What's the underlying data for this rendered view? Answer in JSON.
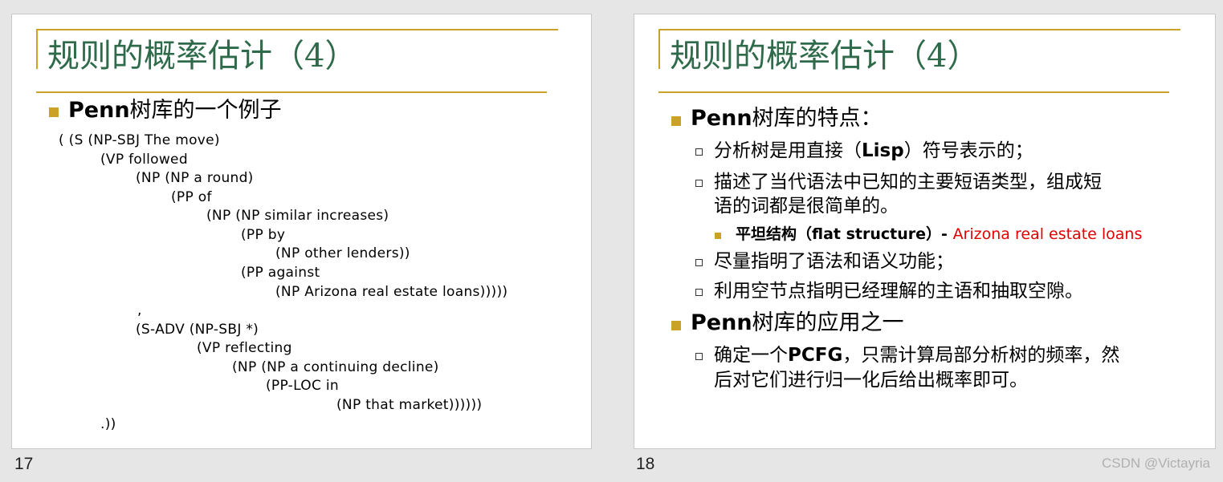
{
  "slide17": {
    "title": "规则的概率估计（4）",
    "heading_bold": "Penn",
    "heading_rest": "树库的一个例子",
    "code_lines": [
      "( (S (NP-SBJ The move)",
      "(VP followed",
      "(NP (NP a round)",
      "(PP of",
      "(NP (NP similar increases)",
      "(PP by",
      "(NP other lenders))",
      "(PP against",
      "(NP Arizona real estate loans)))))",
      ",",
      "(S-ADV (NP-SBJ *)",
      "(VP reflecting",
      "(NP (NP a continuing decline)",
      "(PP-LOC in",
      "(NP that market))))))",
      ".))"
    ],
    "page_number": "17"
  },
  "slide18": {
    "title": "规则的概率估计（4）",
    "bullet1_bold": "Penn",
    "bullet1_rest": "树库的特点：",
    "sub1_pre": "分析树是用直接（",
    "sub1_bold": "Lisp",
    "sub1_post": "）符号表示的；",
    "sub2_line1": "描述了当代语法中已知的主要短语类型，组成短",
    "sub2_line2": "语的词都是很简单的。",
    "subsub_pre": "平坦结构（",
    "subsub_bold": "flat structure",
    "subsub_post": "）- ",
    "subsub_red": "Arizona real estate loans",
    "sub3": "尽量指明了语法和语义功能；",
    "sub4": "利用空节点指明已经理解的主语和抽取空隙。",
    "bullet2_bold": "Penn",
    "bullet2_rest": "树库的应用之一",
    "sub5_pre": "确定一个",
    "sub5_bold": "PCFG",
    "sub5_post": "，只需计算局部分析树的频率，然",
    "sub5_line2": "后对它们进行归一化后给出概率即可。",
    "page_number": "18"
  },
  "watermark": "CSDN @Victayria",
  "colors": {
    "title_green": "#2f6b4a",
    "accent_gold": "#c9a227",
    "highlight_red": "#e00000"
  }
}
